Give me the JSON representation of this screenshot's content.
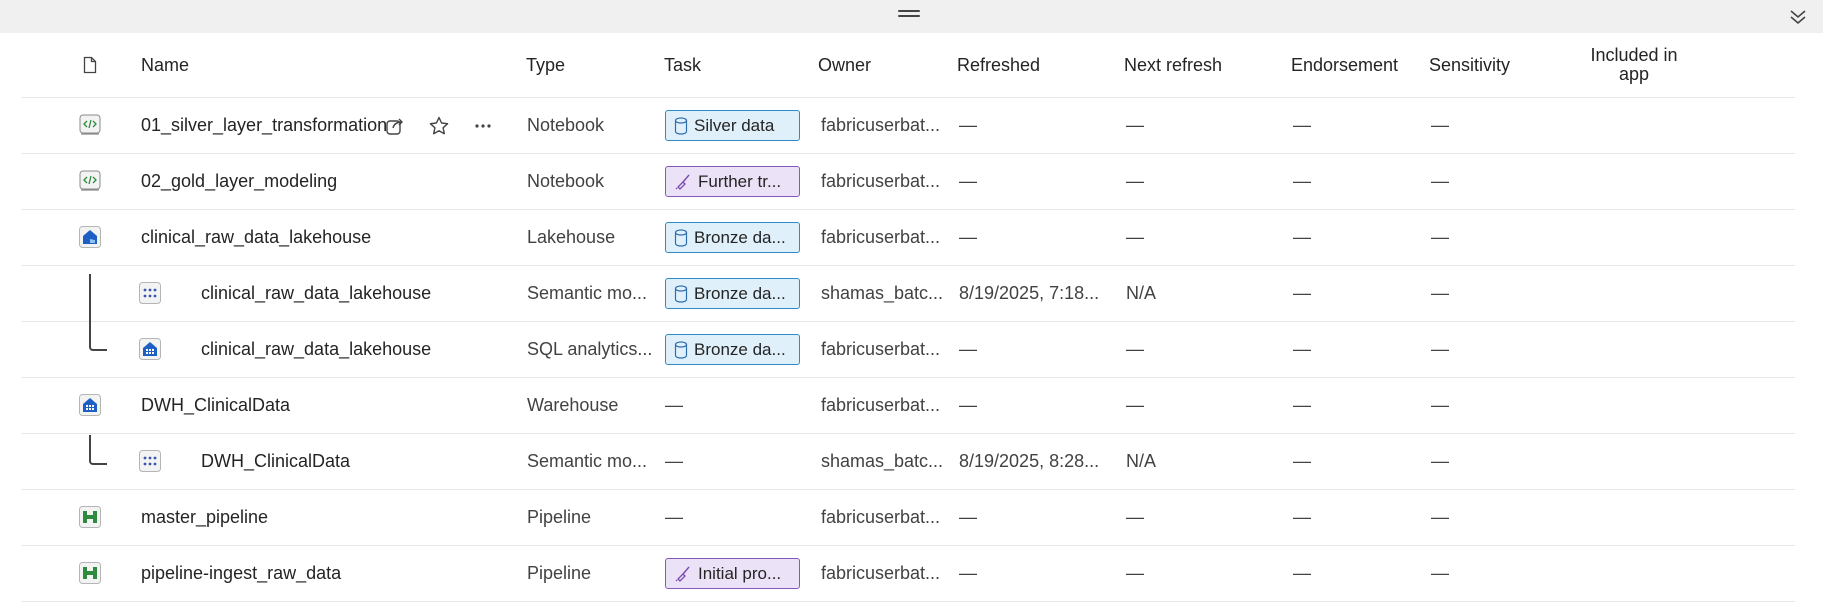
{
  "columns": {
    "icon": "file-icon",
    "name": "Name",
    "type": "Type",
    "task": "Task",
    "owner": "Owner",
    "refreshed": "Refreshed",
    "next_refresh": "Next refresh",
    "endorsement": "Endorsement",
    "sensitivity": "Sensitivity",
    "included_in_app_line1": "Included in",
    "included_in_app_line2": "app"
  },
  "rows": [
    {
      "icon": "notebook-icon",
      "name": "01_silver_layer_transformation",
      "type": "Notebook",
      "task": "Silver data",
      "task_style": "blue",
      "owner": "fabricuserbat...",
      "refreshed": "—",
      "next_refresh": "—",
      "endorsement": "—",
      "sensitivity": "—"
    },
    {
      "icon": "notebook-icon",
      "name": "02_gold_layer_modeling",
      "type": "Notebook",
      "task": "Further tr...",
      "task_style": "purple",
      "owner": "fabricuserbat...",
      "refreshed": "—",
      "next_refresh": "—",
      "endorsement": "—",
      "sensitivity": "—"
    },
    {
      "icon": "lakehouse-icon",
      "name": "clinical_raw_data_lakehouse",
      "type": "Lakehouse",
      "task": "Bronze da...",
      "task_style": "blue",
      "owner": "fabricuserbat...",
      "refreshed": "—",
      "next_refresh": "—",
      "endorsement": "—",
      "sensitivity": "—"
    },
    {
      "icon": "semantic-model-icon",
      "name": "clinical_raw_data_lakehouse",
      "type": "Semantic mo...",
      "task": "Bronze da...",
      "task_style": "blue",
      "owner": "shamas_batc...",
      "refreshed": "8/19/2025, 7:18...",
      "next_refresh": "N/A",
      "endorsement": "—",
      "sensitivity": "—"
    },
    {
      "icon": "sql-endpoint-icon",
      "name": "clinical_raw_data_lakehouse",
      "type": "SQL analytics...",
      "task": "Bronze da...",
      "task_style": "blue",
      "owner": "fabricuserbat...",
      "refreshed": "—",
      "next_refresh": "—",
      "endorsement": "—",
      "sensitivity": "—"
    },
    {
      "icon": "warehouse-icon",
      "name": "DWH_ClinicalData",
      "type": "Warehouse",
      "task": "—",
      "task_style": "none",
      "owner": "fabricuserbat...",
      "refreshed": "—",
      "next_refresh": "—",
      "endorsement": "—",
      "sensitivity": "—"
    },
    {
      "icon": "semantic-model-icon",
      "name": "DWH_ClinicalData",
      "type": "Semantic mo...",
      "task": "—",
      "task_style": "none",
      "owner": "shamas_batc...",
      "refreshed": "8/19/2025, 8:28...",
      "next_refresh": "N/A",
      "endorsement": "—",
      "sensitivity": "—"
    },
    {
      "icon": "pipeline-icon",
      "name": "master_pipeline",
      "type": "Pipeline",
      "task": "—",
      "task_style": "none",
      "owner": "fabricuserbat...",
      "refreshed": "—",
      "next_refresh": "—",
      "endorsement": "—",
      "sensitivity": "—"
    },
    {
      "icon": "pipeline-icon",
      "name": "pipeline-ingest_raw_data",
      "type": "Pipeline",
      "task": "Initial pro...",
      "task_style": "purple",
      "owner": "fabricuserbat...",
      "refreshed": "—",
      "next_refresh": "—",
      "endorsement": "—",
      "sensitivity": "—"
    }
  ],
  "row_actions": [
    "share-icon",
    "favorite-star-icon",
    "more-options-icon"
  ],
  "colors": {
    "task_blue_bg": "#dff0fb",
    "task_blue_border": "#2f8ac8",
    "task_purple_bg": "#ece2f7",
    "task_purple_border": "#8659b8"
  }
}
